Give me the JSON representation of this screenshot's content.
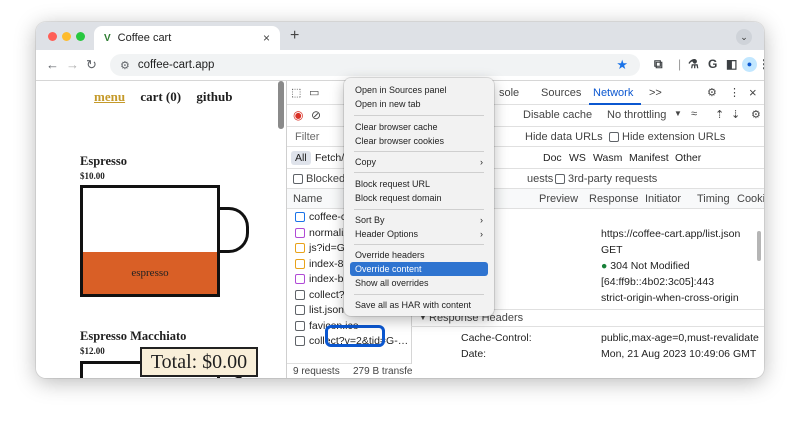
{
  "browser": {
    "tab_title": "Coffee cart",
    "tab_favicon": "V",
    "new_tab": "+",
    "tab_menu": "⌄",
    "url": "coffee-cart.app"
  },
  "page": {
    "nav": {
      "menu": "menu",
      "cart": "cart (0)",
      "github": "github"
    },
    "products": [
      {
        "name": "Espresso",
        "price": "$10.00",
        "fill_label": "espresso"
      },
      {
        "name": "Espresso Macchiato",
        "price": "$12.00"
      }
    ],
    "total": "Total: $0.00"
  },
  "devtools": {
    "tabs": [
      "sole",
      "Sources",
      "Network",
      ">>"
    ],
    "active_tab": "Network",
    "toolbar": {
      "disable_cache": "Disable cache",
      "throttling": "No throttling"
    },
    "filter_placeholder": "Filter",
    "filter_row": {
      "hide_data_urls": "Hide data URLs",
      "hide_extension_urls": "Hide extension URLs"
    },
    "type_filters": [
      "All",
      "Fetch/X",
      "Doc",
      "WS",
      "Wasm",
      "Manifest",
      "Other"
    ],
    "blocked_row": {
      "blocked": "Blocked",
      "requests": "uests",
      "third_party": "3rd-party requests"
    },
    "columns": {
      "name": "Name"
    },
    "detail_tabs": [
      "Preview",
      "Response",
      "Initiator",
      "Timing",
      "Cookies"
    ],
    "requests": [
      {
        "name": "coffee-ca",
        "color": "#1a73e8"
      },
      {
        "name": "normalize",
        "color": "#b04ad6"
      },
      {
        "name": "js?id=G-L",
        "color": "#e8a21a"
      },
      {
        "name": "index-8bf",
        "color": "#e8a21a"
      },
      {
        "name": "index-b85",
        "color": "#b04ad6"
      },
      {
        "name": "collect?v=",
        "color": "#5f6368"
      },
      {
        "name": "list.json",
        "color": "#5f6368"
      },
      {
        "name": "favicon.ico",
        "color": "#5f6368"
      },
      {
        "name": "collect?v=2&tid=G-…",
        "color": "#5f6368"
      }
    ],
    "general": {
      "url": "https://coffee-cart.app/list.json",
      "method": "GET",
      "status": "304 Not Modified",
      "remote": "[64:ff9b::4b02:3c05]:443",
      "policy": "strict-origin-when-cross-origin"
    },
    "response_headers_title": "Response Headers",
    "response_headers": [
      {
        "key": "Cache-Control:",
        "value": "public,max-age=0,must-revalidate"
      },
      {
        "key": "Date:",
        "value": "Mon, 21 Aug 2023 10:49:06 GMT"
      }
    ],
    "summary": {
      "requests": "9 requests",
      "transferred": "279 B transfe"
    }
  },
  "context_menu": {
    "items": [
      "Open in Sources panel",
      "Open in new tab",
      "Clear browser cache",
      "Clear browser cookies",
      "Copy",
      "Block request URL",
      "Block request domain",
      "Sort By",
      "Header Options",
      "Override headers",
      "Override content",
      "Show all overrides",
      "Save all as HAR with content"
    ],
    "selected": "Override content"
  },
  "colors": {
    "accent": "#0b57d0",
    "menu_selected": "#2f74d0",
    "espresso_fill": "#d95f26",
    "status_ok": "#188038"
  }
}
